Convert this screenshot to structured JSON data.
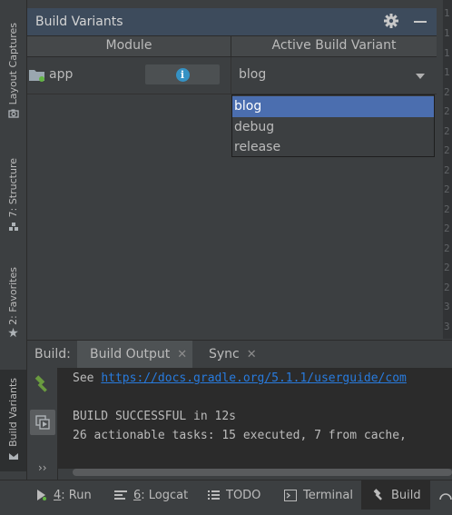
{
  "left_strip": {
    "tabs": [
      {
        "label": "Layout Captures",
        "icon": "camera-icon"
      },
      {
        "label": "7: Structure",
        "icon": "structure-icon"
      },
      {
        "label": "2: Favorites",
        "icon": "star-icon"
      },
      {
        "label": "Build Variants",
        "icon": "build-variants-icon",
        "active": true
      }
    ]
  },
  "gutter": {
    "line_numbers": [
      "1",
      "1",
      "1",
      "1",
      "2",
      "2",
      "2",
      "2",
      "2",
      "2",
      "2",
      "2",
      "2",
      "2",
      "2",
      "3",
      "3",
      "3"
    ]
  },
  "build_variants": {
    "title": "Build Variants",
    "columns": {
      "module": "Module",
      "active_variant": "Active Build Variant"
    },
    "row": {
      "module": "app",
      "selected_variant": "blog"
    },
    "dropdown": {
      "options": [
        "blog",
        "debug",
        "release"
      ],
      "selected_index": 0
    }
  },
  "build_window": {
    "label": "Build:",
    "tabs": [
      {
        "label": "Build Output",
        "active": true
      },
      {
        "label": "Sync",
        "active": false
      }
    ],
    "console": {
      "see_prefix": "See ",
      "link": "https://docs.gradle.org/5.1.1/userguide/com",
      "success": "BUILD SUCCESSFUL in 12s",
      "tasks": "26 actionable tasks: 15 executed, 7 from cache,"
    }
  },
  "bottom_bar": {
    "run": {
      "key": "4",
      "label": ": Run"
    },
    "logcat": {
      "key": "6",
      "label": ": Logcat"
    },
    "todo": "TODO",
    "terminal": "Terminal",
    "build": "Build"
  },
  "colors": {
    "accent": "#4b6eaf",
    "link": "#287bde",
    "header_bg": "#3d4b5c",
    "hammer": "#6a9b3f"
  }
}
